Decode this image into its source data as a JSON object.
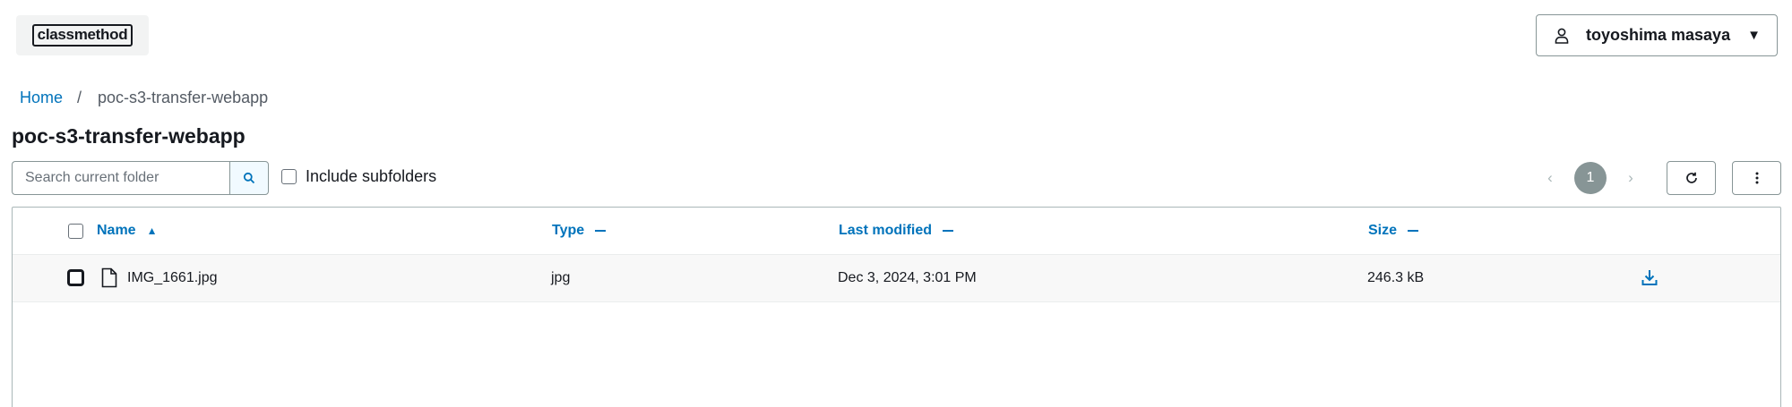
{
  "header": {
    "logo_text": "classmethod",
    "user_name": "toyoshima masaya",
    "user_icon": "user-icon",
    "caret_icon": "caret-down-icon"
  },
  "breadcrumb": {
    "home": "Home",
    "separator": "/",
    "current": "poc-s3-transfer-webapp"
  },
  "page": {
    "title": "poc-s3-transfer-webapp"
  },
  "toolbar": {
    "search_placeholder": "Search current folder",
    "search_icon": "search-icon",
    "include_subfolders_label": "Include subfolders",
    "include_subfolders_checked": false,
    "pagination": {
      "current_page": "1",
      "prev_icon": "chevron-left-icon",
      "next_icon": "chevron-right-icon"
    },
    "refresh_icon": "refresh-icon",
    "more_icon": "more-vertical-icon"
  },
  "table": {
    "columns": [
      {
        "label": "Name",
        "sort": "ascending"
      },
      {
        "label": "Type",
        "sort": "none"
      },
      {
        "label": "Last modified",
        "sort": "none"
      },
      {
        "label": "Size",
        "sort": "none"
      }
    ],
    "rows": [
      {
        "name": "IMG_1661.jpg",
        "type": "jpg",
        "last_modified": "Dec 3, 2024, 3:01 PM",
        "size": "246.3 kB",
        "file_icon": "file-icon",
        "action_icon": "download-icon"
      }
    ]
  },
  "colors": {
    "link": "#0073bb",
    "text": "#16191f",
    "border": "#879596",
    "pager_active": "#879596",
    "search_button_bg": "#f1faff"
  }
}
